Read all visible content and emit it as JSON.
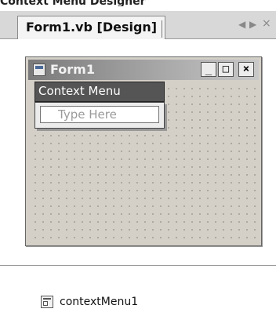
{
  "header_partial": "Context Menu Designer",
  "tab": {
    "label": "Form1.vb [Design]"
  },
  "nav": {
    "left": "◀",
    "right": "▶",
    "close": "×"
  },
  "form": {
    "title": "Form1",
    "caption_buttons": {
      "minimize": "_",
      "maximize": "□",
      "close": "×"
    },
    "menu": {
      "label": "Context Menu",
      "placeholder": "Type Here"
    }
  },
  "tray": {
    "component_label": "contextMenu1"
  }
}
